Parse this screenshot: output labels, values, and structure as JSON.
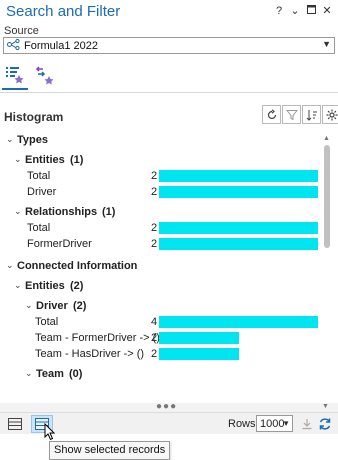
{
  "window": {
    "title": "Search and Filter",
    "controls": [
      "?",
      "⌄",
      "▫",
      "✕"
    ]
  },
  "source": {
    "label": "Source",
    "value": "Formula1 2022"
  },
  "histogram": {
    "title": "Histogram"
  },
  "tree": [
    {
      "kind": "group",
      "level": 0,
      "label": "Types"
    },
    {
      "kind": "group",
      "level": 1,
      "label": "Entities",
      "count_text": "(1)"
    },
    {
      "kind": "item",
      "level": 2,
      "label": "Total",
      "count": 2,
      "fraction": 1.0
    },
    {
      "kind": "item",
      "level": 2,
      "label": "Driver",
      "count": 2,
      "fraction": 1.0
    },
    {
      "kind": "group",
      "level": 1,
      "label": "Relationships",
      "count_text": "(1)"
    },
    {
      "kind": "item",
      "level": 2,
      "label": "Total",
      "count": 2,
      "fraction": 1.0
    },
    {
      "kind": "item",
      "level": 2,
      "label": "FormerDriver",
      "count": 2,
      "fraction": 1.0
    },
    {
      "kind": "group",
      "level": 0,
      "label": "Connected Information"
    },
    {
      "kind": "group",
      "level": 1,
      "label": "Entities",
      "count_text": "(2)"
    },
    {
      "kind": "group",
      "level": 2,
      "label": "Driver",
      "count_text": "(2)"
    },
    {
      "kind": "item",
      "level": 3,
      "label": "Total",
      "count": 4,
      "fraction": 1.0
    },
    {
      "kind": "item",
      "level": 3,
      "label": "Team - FormerDriver -> ()",
      "count": 2,
      "fraction": 0.5
    },
    {
      "kind": "item",
      "level": 3,
      "label": "Team - HasDriver -> ()",
      "count": 2,
      "fraction": 0.5
    },
    {
      "kind": "group",
      "level": 2,
      "label": "Team",
      "count_text": "(0)"
    }
  ],
  "bottom": {
    "rows_label": "Rows:",
    "rows_value": "1000"
  },
  "tooltip": {
    "text": "Show selected records"
  },
  "colors": {
    "accent": "#1b6cb3",
    "bar": "#00e5f0",
    "selected_bg": "#cfe3f6"
  }
}
